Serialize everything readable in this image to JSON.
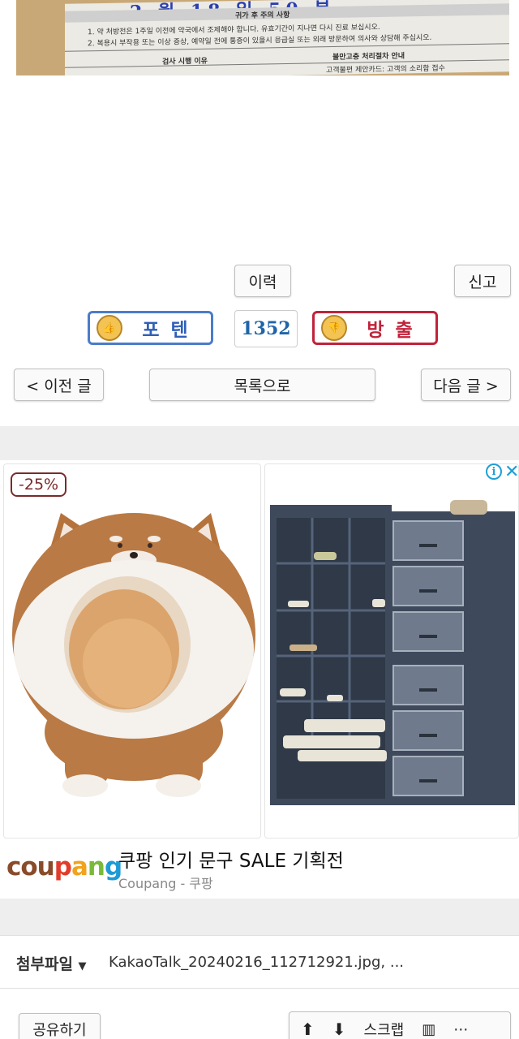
{
  "doc_photo": {
    "handwriting": "2 월 18 일 50 분",
    "notice_title": "귀가 후 주의 사항",
    "line1": "1. 약 처방전은 1주일 이전에 약국에서 조제해야 합니다. 유효기간이 지나면 다시 진료 보십시오.",
    "line2": "2. 복용시 부작용 또는 이상 증상, 예약일 전에 통증이 있을시 응급실 또는 외래 방문하여 의사와 상담해 주십시오.",
    "col_left": "검사 시행 이유",
    "col_right": "불만고충 처리절차 안내",
    "col_right_sub": "고객불편 제안카드: 고객의 소리함 접수"
  },
  "actions": {
    "history_label": "이력",
    "report_label": "신고"
  },
  "votes": {
    "up_label": "포텐",
    "count": "1352",
    "down_label": "방출",
    "up_color": "#2f5fb8",
    "down_color": "#c0233a"
  },
  "nav": {
    "prev_label": "< 이전 글",
    "list_label": "목록으로",
    "next_label": "다음 글 >"
  },
  "ad": {
    "discount": "-25%",
    "brand": "coupang",
    "title": "쿠팡 인기 문구 SALE 기획전",
    "subtitle": "Coupang - 쿠팡",
    "info_icon": "info-icon",
    "close_icon": "close-icon"
  },
  "attachment": {
    "label": "첨부파일",
    "file": "KakaoTalk_20240216_112712921.jpg,   ..."
  },
  "bottom": {
    "share_label": "공유하기",
    "scrap_label": "스크랩"
  }
}
